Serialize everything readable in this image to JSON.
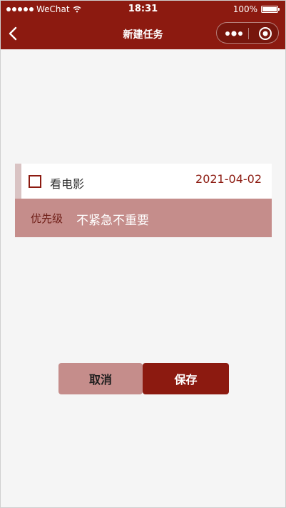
{
  "status_bar": {
    "carrier": "WeChat",
    "time": "18:31",
    "battery": "100%"
  },
  "nav": {
    "title": "新建任务",
    "back_icon": "chevron-left-icon",
    "more_icon": "more-dots-icon",
    "close_icon": "target-circle-icon"
  },
  "task": {
    "name": "看电影",
    "date": "2021-04-02",
    "checked": false,
    "priority_label": "优先级",
    "priority_value": "不紧急不重要"
  },
  "actions": {
    "cancel_label": "取消",
    "save_label": "保存"
  },
  "colors": {
    "brand": "#8c1a10",
    "accent_light": "#c58d8b",
    "background": "#f5f5f5"
  }
}
